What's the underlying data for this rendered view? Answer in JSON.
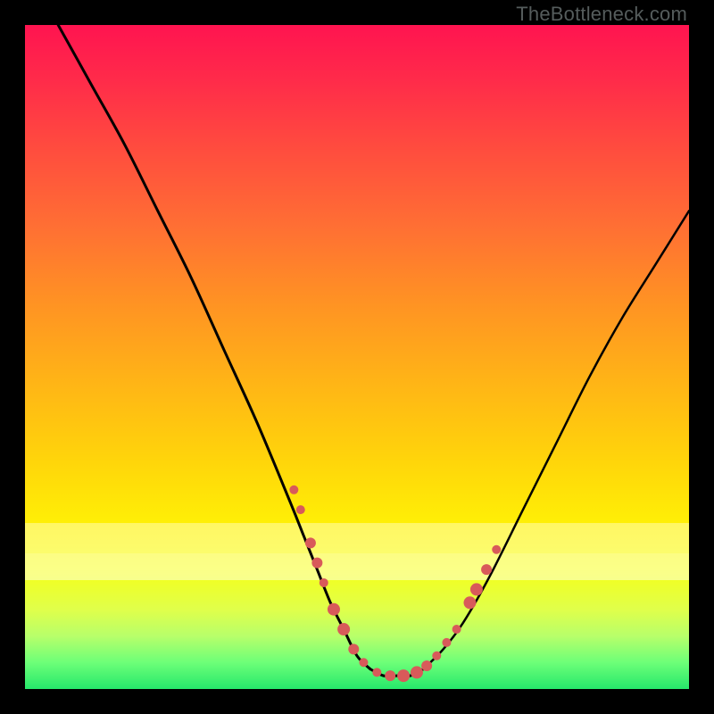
{
  "watermark": "TheBottleneck.com",
  "chart_data": {
    "type": "line",
    "title": "",
    "xlabel": "",
    "ylabel": "",
    "xlim": [
      0,
      100
    ],
    "ylim": [
      0,
      100
    ],
    "grid": false,
    "legend": false,
    "series": [
      {
        "name": "left-curve",
        "color": "#000000",
        "stroke_width": 3,
        "x": [
          5,
          10,
          15,
          20,
          25,
          30,
          35,
          40,
          42,
          44,
          46,
          48,
          50,
          52
        ],
        "y": [
          100,
          91,
          82,
          72,
          62,
          51,
          40,
          28,
          23,
          18,
          13,
          9,
          5,
          3
        ]
      },
      {
        "name": "valley-floor",
        "color": "#000000",
        "stroke_width": 3,
        "x": [
          52,
          54,
          56,
          58,
          60
        ],
        "y": [
          3,
          2,
          2,
          2,
          3
        ]
      },
      {
        "name": "right-curve",
        "color": "#000000",
        "stroke_width": 2.5,
        "x": [
          60,
          63,
          66,
          70,
          75,
          80,
          85,
          90,
          95,
          100
        ],
        "y": [
          3,
          6,
          10,
          17,
          27,
          37,
          47,
          56,
          64,
          72
        ]
      }
    ],
    "markers": {
      "name": "highlight-dots",
      "color": "#d85a5a",
      "radius_sequence": [
        5,
        5,
        6,
        6,
        5,
        7,
        7,
        6,
        5,
        5,
        6,
        7,
        7,
        6,
        5,
        5,
        5,
        7,
        7,
        6,
        5
      ],
      "points": [
        {
          "x": 40.5,
          "y": 30
        },
        {
          "x": 41.5,
          "y": 27
        },
        {
          "x": 43.0,
          "y": 22
        },
        {
          "x": 44.0,
          "y": 19
        },
        {
          "x": 45.0,
          "y": 16
        },
        {
          "x": 46.5,
          "y": 12
        },
        {
          "x": 48.0,
          "y": 9
        },
        {
          "x": 49.5,
          "y": 6
        },
        {
          "x": 51.0,
          "y": 4
        },
        {
          "x": 53.0,
          "y": 2.5
        },
        {
          "x": 55.0,
          "y": 2
        },
        {
          "x": 57.0,
          "y": 2
        },
        {
          "x": 59.0,
          "y": 2.5
        },
        {
          "x": 60.5,
          "y": 3.5
        },
        {
          "x": 62.0,
          "y": 5
        },
        {
          "x": 63.5,
          "y": 7
        },
        {
          "x": 65.0,
          "y": 9
        },
        {
          "x": 67.0,
          "y": 13
        },
        {
          "x": 68.0,
          "y": 15
        },
        {
          "x": 69.5,
          "y": 18
        },
        {
          "x": 71.0,
          "y": 21
        }
      ]
    }
  }
}
